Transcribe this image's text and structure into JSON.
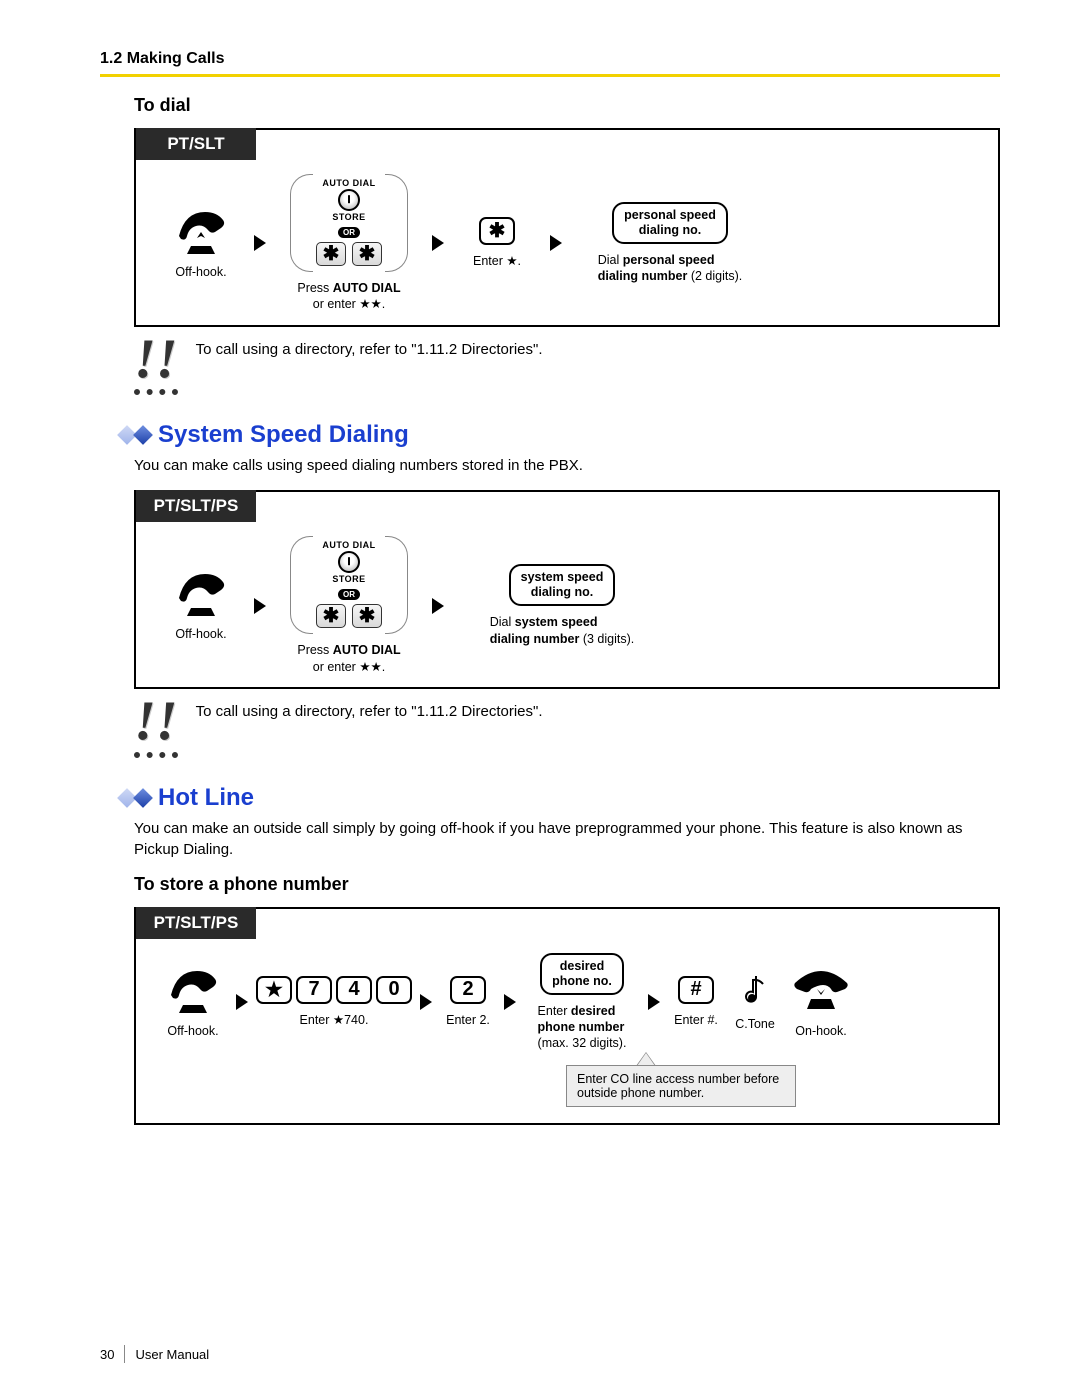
{
  "header": {
    "breadcrumb": "1.2 Making Calls"
  },
  "to_dial": {
    "heading": "To dial",
    "tab": "PT/SLT",
    "offhook_caption": "Off-hook.",
    "autodial": {
      "top": "AUTO DIAL",
      "bottom": "STORE",
      "or": "OR"
    },
    "autodial_caption_1": "Press ",
    "autodial_caption_bold": "AUTO DIAL",
    "autodial_caption_2": "or enter ★★.",
    "enter_star_caption": "Enter ★.",
    "info_line1": "personal speed",
    "info_line2": "dialing no.",
    "dial_caption_1": "Dial ",
    "dial_caption_bold": "personal speed",
    "dial_caption_bold2": "dialing number",
    "dial_caption_2": " (2 digits).",
    "note": "To call using a directory, refer to \"1.11.2 Directories\"."
  },
  "sys_speed": {
    "title": "System Speed Dialing",
    "desc": "You can make calls using speed dialing numbers stored in the PBX.",
    "tab": "PT/SLT/PS",
    "offhook_caption": "Off-hook.",
    "autodial_caption_1": "Press ",
    "autodial_caption_bold": "AUTO DIAL",
    "autodial_caption_2": "or enter ★★.",
    "info_line1": "system speed",
    "info_line2": "dialing no.",
    "dial_caption_1": "Dial ",
    "dial_caption_bold": "system speed",
    "dial_caption_bold2": "dialing number",
    "dial_caption_2": " (3 digits).",
    "note": "To call using a directory, refer to \"1.11.2 Directories\"."
  },
  "hotline": {
    "title": "Hot Line",
    "desc": "You can make an outside call simply by going off-hook if you have preprogrammed your phone. This feature is also known as Pickup Dialing.",
    "sub": "To store a phone number",
    "tab": "PT/SLT/PS",
    "offhook_caption": "Off-hook.",
    "keys": [
      "★",
      "7",
      "4",
      "0"
    ],
    "enter740": "Enter ★740.",
    "key2": "2",
    "enter2": "Enter 2.",
    "desired1": "desired",
    "desired2": "phone no.",
    "enter_desired_1": "Enter ",
    "enter_desired_bold": "desired",
    "enter_desired_bold2": "phone number",
    "enter_desired_2": "(max. 32 digits).",
    "hash": "#",
    "enter_hash": "Enter #.",
    "ctone": "C.Tone",
    "onhook": "On-hook.",
    "callout": "Enter CO line access number before outside phone number."
  },
  "footer": {
    "page": "30",
    "label": "User Manual"
  },
  "bang": "!!"
}
